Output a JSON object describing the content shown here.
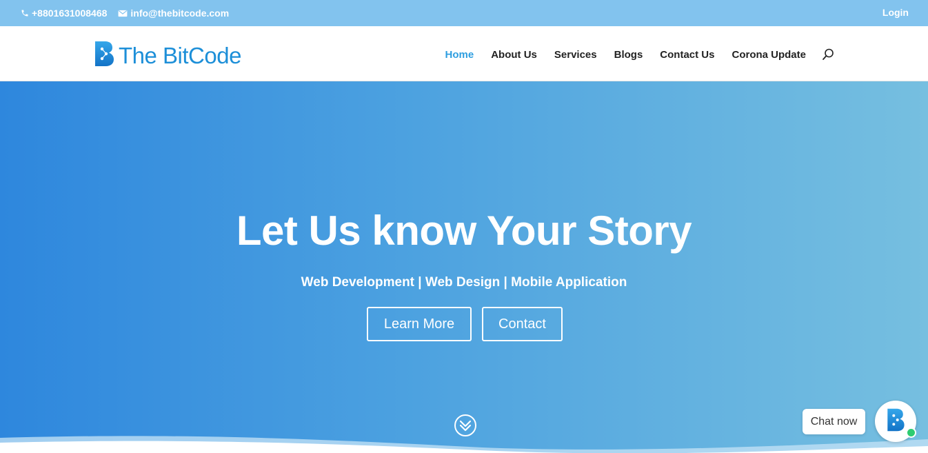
{
  "topbar": {
    "phone": "+8801631008468",
    "email": "info@thebitcode.com",
    "login": "Login",
    "phone_icon": "phone-icon",
    "email_icon": "envelope-icon"
  },
  "header": {
    "logo_text": "The BitCode",
    "nav": {
      "home": "Home",
      "about": "About Us",
      "services": "Services",
      "blogs": "Blogs",
      "contact": "Contact Us",
      "corona": "Corona Update"
    },
    "search_icon": "search-icon"
  },
  "hero": {
    "title": "Let Us know Your Story",
    "subtitle": "Web Development | Web Design | Mobile Application",
    "learn_more": "Learn More",
    "contact": "Contact",
    "scroll_icon": "double-chevron-down-icon"
  },
  "chat": {
    "label": "Chat now",
    "status": "online"
  },
  "colors": {
    "topbar": "#82c3ee",
    "brand": "#1d8fd8",
    "nav_active": "#2e9ee0",
    "hero_start": "#2e87dd",
    "hero_end": "#76bfe0",
    "online": "#2ecc71"
  }
}
